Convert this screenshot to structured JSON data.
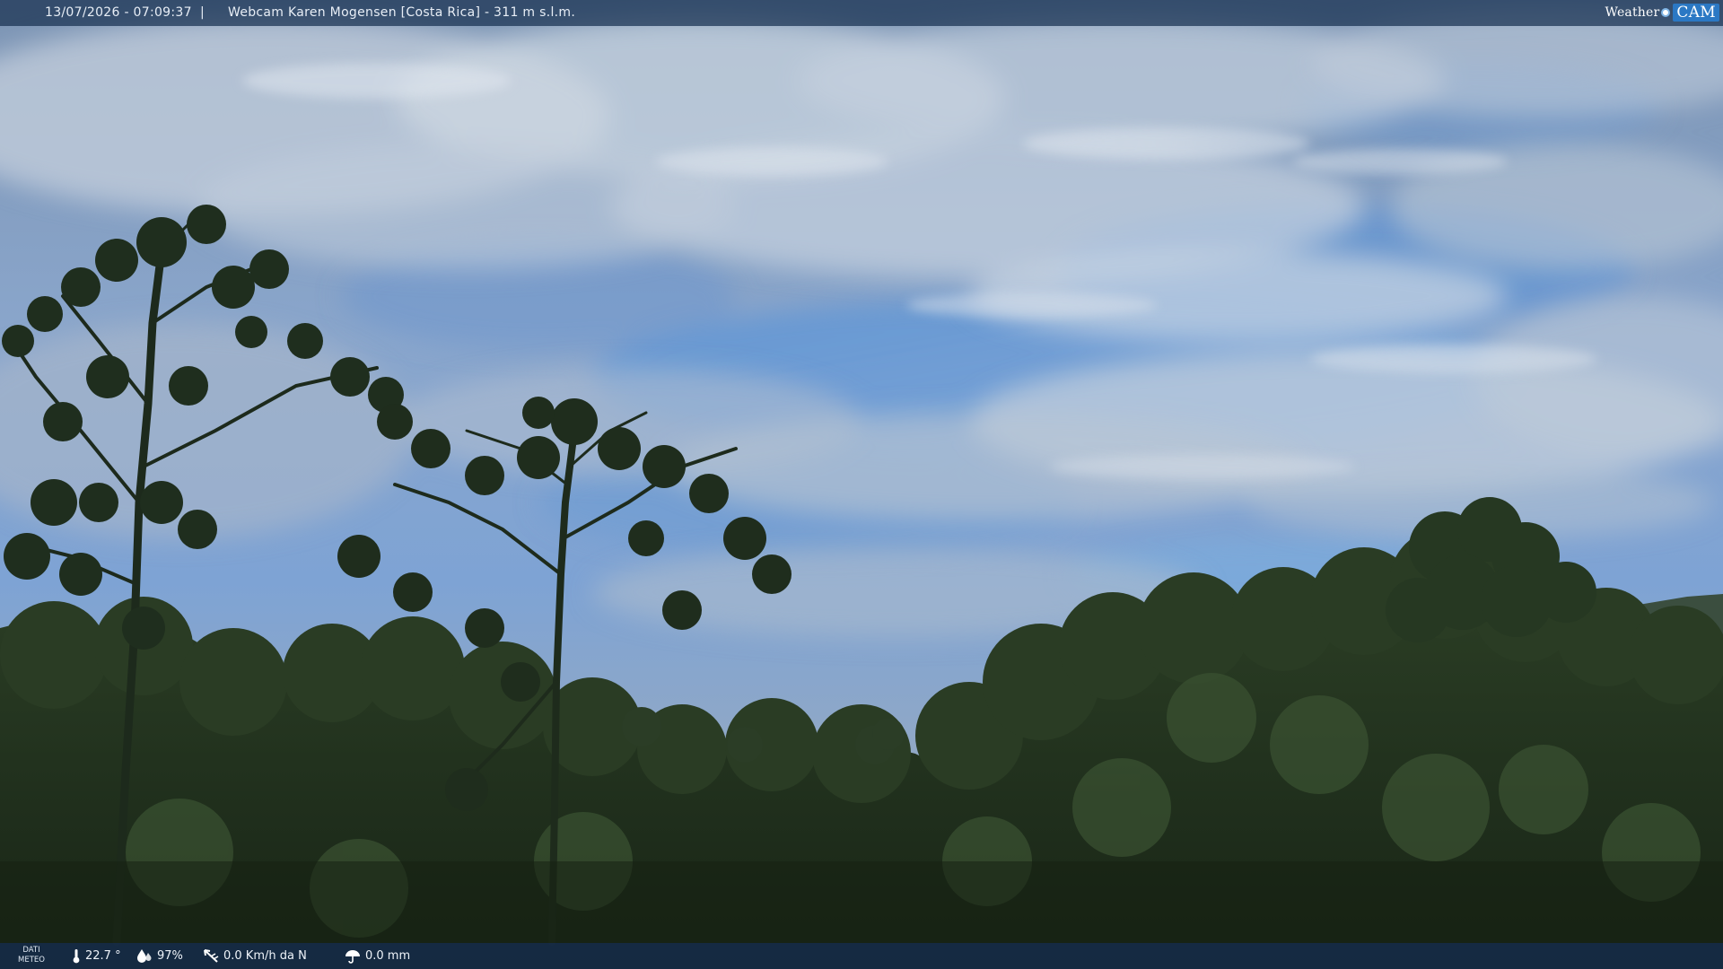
{
  "overlay": {
    "timestamp": "13/07/2026 - 07:09:37",
    "separator": "|",
    "caption": "Webcam Karen Mogensen [Costa Rica] - 311 m s.l.m.",
    "logo": {
      "part1": "Weather",
      "part2": "CAM"
    }
  },
  "weather": {
    "label_line1": "DATI",
    "label_line2": "METEO",
    "temperature": "22.7 °",
    "humidity": "97%",
    "wind": "0.0 Km/h da N",
    "rain": "0.0 mm",
    "icons": [
      "thermometer-icon",
      "humidity-icon",
      "wind-icon",
      "rain-icon"
    ]
  },
  "colors": {
    "sky_top": "#8fa7c4",
    "sky_mid": "#6f9ad0",
    "foliage_dark": "#1c2a1a",
    "foliage_mid": "#2f4428",
    "bar_bg": "#183050"
  }
}
